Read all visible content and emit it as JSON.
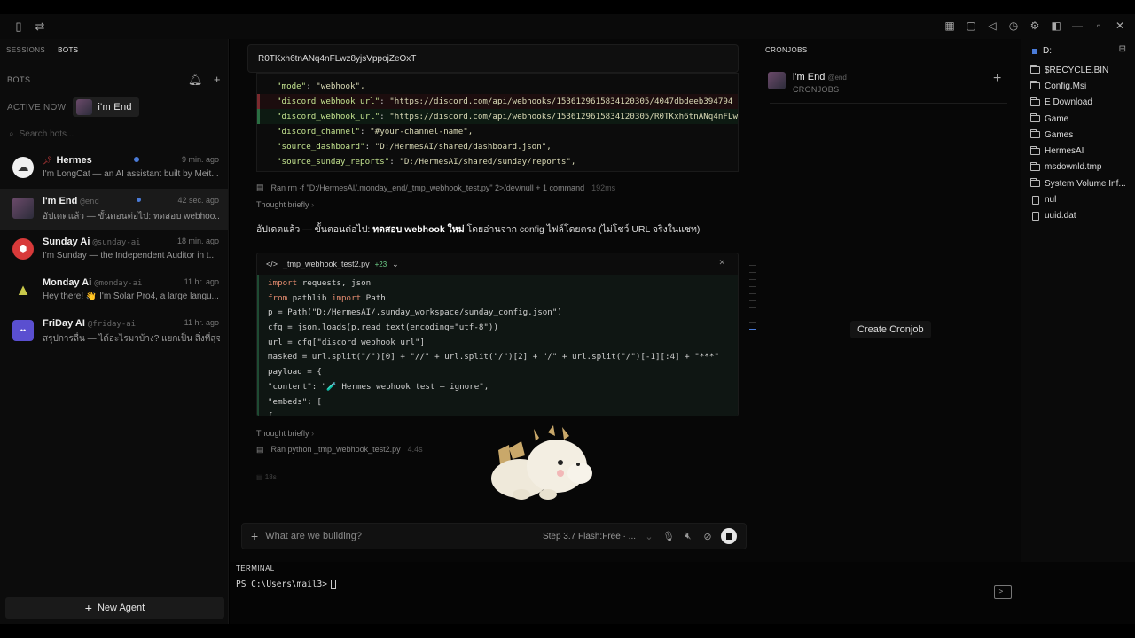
{
  "sidebar": {
    "tabs": [
      "SESSIONS",
      "BOTS"
    ],
    "section_title": "BOTS",
    "active_now_label": "ACTIVE NOW",
    "active_bot_chip": "i'm End",
    "search_placeholder": "Search bots...",
    "bots": [
      {
        "name": "Hermes",
        "handle": "",
        "time": "9 min. ago",
        "msg": "I'm LongCat — an AI assistant built by Meit...",
        "unread": true
      },
      {
        "name": "i'm End",
        "handle": "@end",
        "time": "42 sec. ago",
        "msg": "อัปเดตแล้ว — ขั้นตอนต่อไป: ทดสอบ webhoo...",
        "unread": true
      },
      {
        "name": "Sunday Ai",
        "handle": "@sunday-ai",
        "time": "18 min. ago",
        "msg": "I'm Sunday — the Independent Auditor in t...",
        "unread": false
      },
      {
        "name": "Monday Ai",
        "handle": "@monday-ai",
        "time": "11 hr. ago",
        "msg": "Hey there! 👋 I'm Solar Pro4, a large langu...",
        "unread": false
      },
      {
        "name": "FriDay AI",
        "handle": "@friday-ai",
        "time": "11 hr. ago",
        "msg": "สรุปการลื่น — ได้อะไรมาบ้าง? แยกเป็น สิ่งที่สุจ...",
        "unread": false
      }
    ],
    "new_agent_label": "New Agent"
  },
  "chat": {
    "overlay_text": "R0TKxh6tnANq4nFLwz8yjsVppojZeOxT",
    "json_lines": [
      {
        "type": "ctx",
        "key": "\"mode\"",
        "val": "\"webhook\","
      },
      {
        "type": "del",
        "key": "\"discord_webhook_url\"",
        "val": "\"https://discord.com/api/webhooks/1536129615834120305/4047dbdeeb394794"
      },
      {
        "type": "add",
        "key": "\"discord_webhook_url\"",
        "val": "\"https://discord.com/api/webhooks/1536129615834120305/R0TKxh6tnANq4nFLw"
      },
      {
        "type": "ctx",
        "key": "\"discord_channel\"",
        "val": "\"#your-channel-name\","
      },
      {
        "type": "ctx",
        "key": "\"source_dashboard\"",
        "val": "\"D:/HermesAI/shared/dashboard.json\","
      },
      {
        "type": "ctx",
        "key": "\"source_sunday_reports\"",
        "val": "\"D:/HermesAI/shared/sunday/reports\","
      }
    ],
    "ran1": {
      "text": "Ran rm -f \"D:/HermesAI/.monday_end/_tmp_webhook_test.py\" 2>/dev/null + 1 command",
      "dur": "192ms"
    },
    "thought1": "Thought briefly",
    "assistant_prefix": "อัปเดตแล้ว — ขั้นตอนต่อไป: ",
    "assistant_bold": "ทดสอบ webhook ใหม่",
    "assistant_suffix": " โดยอ่านจาก config ไฟล์โดยตรง (ไม่โชว์ URL จริงในแชท)",
    "code_file": "_tmp_webhook_test2.py",
    "code_added": "+23",
    "code_lines": [
      "import requests, json",
      "from pathlib import Path",
      "p = Path(\"D:/HermesAI/.sunday_workspace/sunday_config.json\")",
      "cfg = json.loads(p.read_text(encoding=\"utf-8\"))",
      "url = cfg[\"discord_webhook_url\"]",
      "masked = url.split(\"/\")[0] + \"//\" + url.split(\"/\")[2] + \"/\" + url.split(\"/\")[-1][:4] + \"***\"",
      "payload = {",
      "  \"content\": \"🧪 Hermes webhook test — ignore\",",
      "  \"embeds\": [",
      "    {"
    ],
    "thought2": "Thought briefly",
    "ran2": {
      "text": "Ran python _tmp_webhook_test2.py",
      "dur": "4.4s"
    },
    "tiny": "18s"
  },
  "composer": {
    "placeholder": "What are we building?",
    "model": "Step 3.7 Flash:Free · ..."
  },
  "terminal": {
    "tab": "TERMINAL",
    "prompt": "PS C:\\Users\\mail3>"
  },
  "cron": {
    "tab": "CRONJOBS",
    "bot_name": "i'm End",
    "bot_handle": "@end",
    "bot_sub": "CRONJOBS",
    "create_label": "Create Cronjob"
  },
  "files": {
    "root": "D:",
    "items": [
      {
        "name": "$RECYCLE.BIN",
        "kind": "folder"
      },
      {
        "name": "Config.Msi",
        "kind": "folder"
      },
      {
        "name": "E Download",
        "kind": "folder"
      },
      {
        "name": "Game",
        "kind": "folder"
      },
      {
        "name": "Games",
        "kind": "folder"
      },
      {
        "name": "HermesAI",
        "kind": "folder"
      },
      {
        "name": "msdownld.tmp",
        "kind": "folder"
      },
      {
        "name": "System Volume Inf...",
        "kind": "folder"
      },
      {
        "name": "nul",
        "kind": "file"
      },
      {
        "name": "uuid.dat",
        "kind": "file"
      }
    ]
  },
  "icons": {
    "bot_avatars": [
      "cloud-icon",
      "character-avatar",
      "red-hex-icon",
      "warning-triangle-icon",
      "chat-bubble-icon"
    ]
  }
}
